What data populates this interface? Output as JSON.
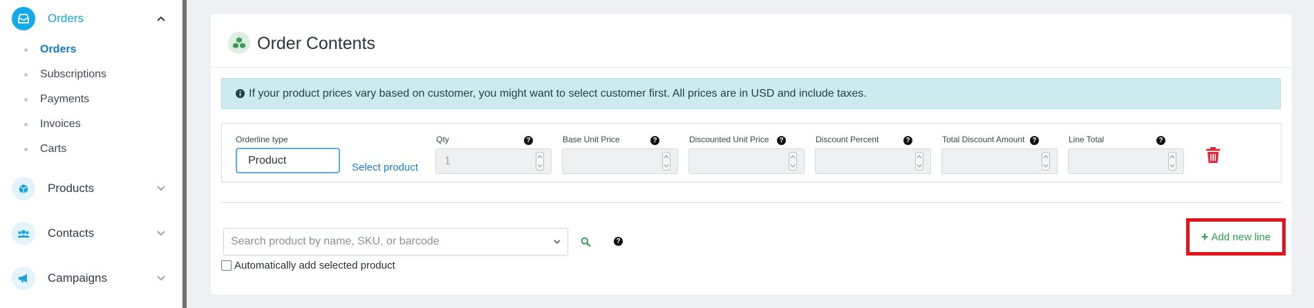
{
  "sidebar": {
    "groups": [
      {
        "label": "Orders",
        "icon": "inbox-icon",
        "expanded": true
      },
      {
        "label": "Products",
        "icon": "box-icon",
        "expanded": false
      },
      {
        "label": "Contacts",
        "icon": "users-icon",
        "expanded": false
      },
      {
        "label": "Campaigns",
        "icon": "megaphone-icon",
        "expanded": false
      }
    ],
    "orders_sub": [
      "Orders",
      "Subscriptions",
      "Payments",
      "Invoices",
      "Carts"
    ],
    "active_sub": "Orders"
  },
  "card": {
    "title": "Order Contents",
    "icon": "cubes-icon",
    "alert": "If your product prices vary based on customer, you might want to select customer first. All prices are in USD and include taxes.",
    "orderline": {
      "type_label": "Orderline type",
      "type_value": "Product",
      "select_product": "Select product",
      "fields": [
        {
          "label": "Qty",
          "value": "1"
        },
        {
          "label": "Base Unit Price",
          "value": ""
        },
        {
          "label": "Discounted Unit Price",
          "value": ""
        },
        {
          "label": "Discount Percent",
          "value": ""
        },
        {
          "label": "Total Discount Amount",
          "value": ""
        },
        {
          "label": "Line Total",
          "value": ""
        }
      ],
      "help_glyph": "?"
    },
    "search": {
      "placeholder": "Search product by name, SKU, or barcode"
    },
    "auto_add_label": "Automatically add selected product",
    "add_new_line": "Add new line"
  },
  "colors": {
    "accent": "#14aaea",
    "link": "#1a7ad4",
    "alert_bg": "#cdebef",
    "success": "#2e9e4f",
    "danger": "#e3121b",
    "trash": "#e0283a"
  }
}
